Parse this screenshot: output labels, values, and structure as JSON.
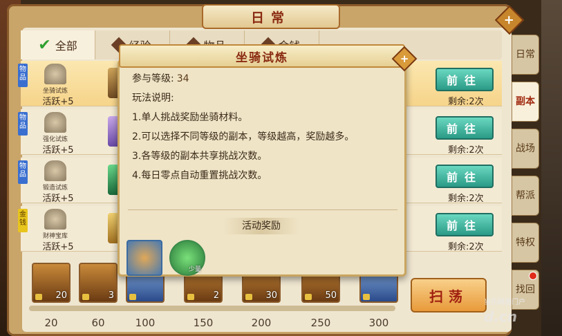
{
  "window": {
    "title": "日常"
  },
  "filters": [
    {
      "label": "全部",
      "icon": "check-icon",
      "active": true
    },
    {
      "label": "经验",
      "icon": "diamond-icon",
      "active": false
    },
    {
      "label": "物品",
      "icon": "diamond-icon",
      "active": false
    },
    {
      "label": "金钱",
      "icon": "diamond-icon",
      "active": false
    }
  ],
  "rows": [
    {
      "tag": "物品",
      "icon_label": "坐骑试炼",
      "active": "活跃+5",
      "go": "前往",
      "remain": "剩余:2次",
      "highlight": true
    },
    {
      "tag": "物品",
      "icon_label": "强化试炼",
      "active": "活跃+5",
      "go": "前往",
      "remain": "剩余:2次",
      "highlight": false
    },
    {
      "tag": "物品",
      "icon_label": "锻造试炼",
      "active": "活跃+5",
      "go": "前往",
      "remain": "剩余:2次",
      "highlight": false
    },
    {
      "tag": "金钱",
      "icon_label": "财神宝库",
      "active": "活跃+5",
      "go": "前往",
      "remain": "剩余:2次",
      "highlight": false
    }
  ],
  "side_tabs": [
    {
      "label": "日常",
      "active": false
    },
    {
      "label": "副本",
      "active": true
    },
    {
      "label": "战场",
      "active": false
    },
    {
      "label": "帮派",
      "active": false
    },
    {
      "label": "特权",
      "active": false
    },
    {
      "label": "找回",
      "active": false,
      "badge": true
    }
  ],
  "chests": [
    {
      "count": "20"
    },
    {
      "count": "3"
    },
    {
      "count": ""
    },
    {
      "count": "2"
    },
    {
      "count": "30"
    },
    {
      "count": "50"
    },
    {
      "count": ""
    }
  ],
  "milestones": [
    "20",
    "60",
    "100",
    "150",
    "200",
    "250",
    "300"
  ],
  "sweep_label": "扫荡",
  "popup": {
    "title": "坐骑试炼",
    "level_label": "参与等级:",
    "level_value": "34",
    "desc_label": "玩法说明:",
    "lines": [
      "1.单人挑战奖励坐骑材料。",
      "2.可以选择不同等级的副本，等级越高，奖励越多。",
      "3.各等级的副本共享挑战次数。",
      "4.每日零点自动重置挑战次数。"
    ],
    "reward_title": "活动奖励",
    "items": [
      {
        "icon": "bread-item-icon",
        "label": ""
      },
      {
        "icon": "exp-orb-icon",
        "label": "少量"
      }
    ]
  },
  "watermark": {
    "line1": "当乐网游门户",
    "line2": "d.cn"
  }
}
